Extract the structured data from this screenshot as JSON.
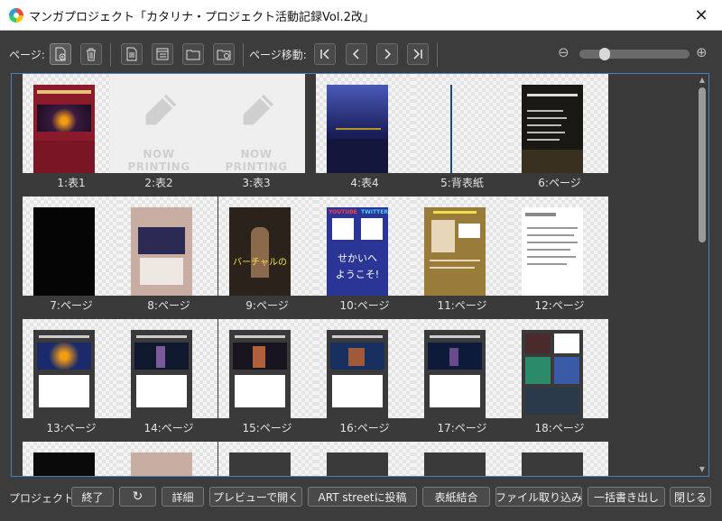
{
  "window": {
    "title": "マンガプロジェクト「カタリナ・プロジェクト活動記録Vol.2改」",
    "close_symbol": "✕"
  },
  "toolbar": {
    "page_label": "ページ:",
    "page_move_label": "ページ移動:",
    "zoom_out": "⊖",
    "zoom_in": "⊕",
    "zoom_level": 0.2
  },
  "pages": [
    {
      "label": "1:表1"
    },
    {
      "label": "2:表2",
      "placeholder": "NOW PRINTING"
    },
    {
      "label": "3:表3",
      "placeholder": "NOW PRINTING"
    },
    {
      "label": "4:表4"
    },
    {
      "label": "5:背表紙"
    },
    {
      "label": "6:ページ"
    },
    {
      "label": "7:ページ"
    },
    {
      "label": "8:ページ"
    },
    {
      "label": "9:ページ",
      "caption": "バーチャルの"
    },
    {
      "label": "10:ページ",
      "caption1": "YOUTUBE",
      "caption2": "TWITTER",
      "caption3": "せかいへ",
      "caption4": "ようこそ!"
    },
    {
      "label": "11:ページ"
    },
    {
      "label": "12:ページ"
    },
    {
      "label": "13:ページ"
    },
    {
      "label": "14:ページ"
    },
    {
      "label": "15:ページ"
    },
    {
      "label": "16:ページ"
    },
    {
      "label": "17:ページ"
    },
    {
      "label": "18:ページ"
    }
  ],
  "bottom": {
    "label": "プロジェクト:",
    "buttons": [
      "終了",
      "↻",
      "詳細",
      "プレビューで開く",
      "ART streetに投稿",
      "表紙結合",
      "ファイル取り込み",
      "一括書き出し",
      "閉じる"
    ]
  }
}
